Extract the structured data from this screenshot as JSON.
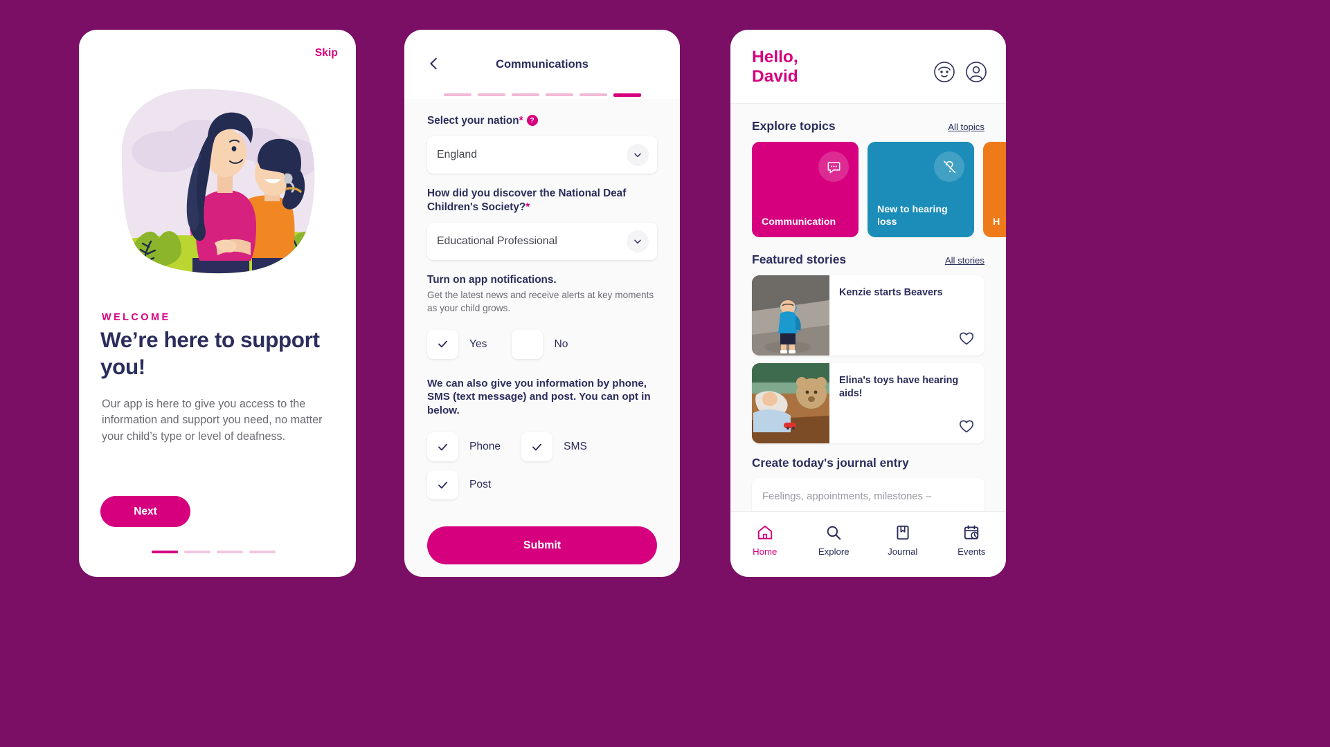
{
  "theme": {
    "background": "#7B0F66",
    "magenta": "#D6007F",
    "navy": "#2B2D5C",
    "teal": "#1B8DB8",
    "orange": "#EE7A1A",
    "grey_text": "#6B6B73"
  },
  "onboarding": {
    "skip_label": "Skip",
    "kicker": "WELCOME",
    "headline": "We’re here to support you!",
    "body": "Our app is here to give you access to the information and support you need, no matter your child’s type or level of deafness.",
    "next_label": "Next",
    "dots_total": 4,
    "dots_active_index": 0,
    "illustration_name": "mother-and-child-illustration"
  },
  "communications": {
    "title": "Communications",
    "back_icon": "chevron-left-icon",
    "steps_total": 6,
    "steps_active_index": 5,
    "nation": {
      "label": "Select your nation",
      "required_marker": "*",
      "help_glyph": "?",
      "value": "England"
    },
    "discover": {
      "label": "How did you discover the National Deaf Children's Society?",
      "required_marker": "*",
      "value": "Educational Professional"
    },
    "notifications": {
      "title": "Turn on app notifications.",
      "subtitle": "Get the latest news and receive alerts at key moments as your child grows.",
      "options": [
        {
          "label": "Yes",
          "checked": true
        },
        {
          "label": "No",
          "checked": false
        }
      ]
    },
    "optin": {
      "text": "We can also give you information by phone, SMS (text message) and post. You can opt in below.",
      "options": [
        {
          "label": "Phone",
          "checked": true
        },
        {
          "label": "SMS",
          "checked": true
        },
        {
          "label": "Post",
          "checked": true
        }
      ]
    },
    "submit_label": "Submit"
  },
  "home": {
    "greeting_line1": "Hello,",
    "greeting_line2": "David",
    "header_icons": [
      {
        "name": "child-face-icon"
      },
      {
        "name": "account-circle-icon"
      }
    ],
    "explore": {
      "title": "Explore topics",
      "link": "All topics",
      "cards": [
        {
          "label": "Communication",
          "color": "#D6007F",
          "icon": "speech-bubble-icon"
        },
        {
          "label": "New to hearing loss",
          "color": "#1B8DB8",
          "icon": "ear-hearing-off-icon"
        },
        {
          "label": "H",
          "color": "#EE7A1A",
          "icon": "topic-icon"
        }
      ]
    },
    "stories": {
      "title": "Featured stories",
      "link": "All stories",
      "items": [
        {
          "title": "Kenzie starts Beavers",
          "thumb": "boy-in-blue-uniform-photo",
          "favourite_icon": "heart-outline-icon"
        },
        {
          "title": "Elina's toys have hearing aids!",
          "thumb": "child-with-teddy-photo",
          "favourite_icon": "heart-outline-icon"
        }
      ]
    },
    "journal": {
      "title": "Create today's journal entry",
      "placeholder": "Feelings, appointments, milestones –"
    },
    "tabs": [
      {
        "label": "Home",
        "icon": "home-icon",
        "active": true
      },
      {
        "label": "Explore",
        "icon": "search-icon",
        "active": false
      },
      {
        "label": "Journal",
        "icon": "book-icon",
        "active": false
      },
      {
        "label": "Events",
        "icon": "calendar-clock-icon",
        "active": false
      }
    ]
  }
}
